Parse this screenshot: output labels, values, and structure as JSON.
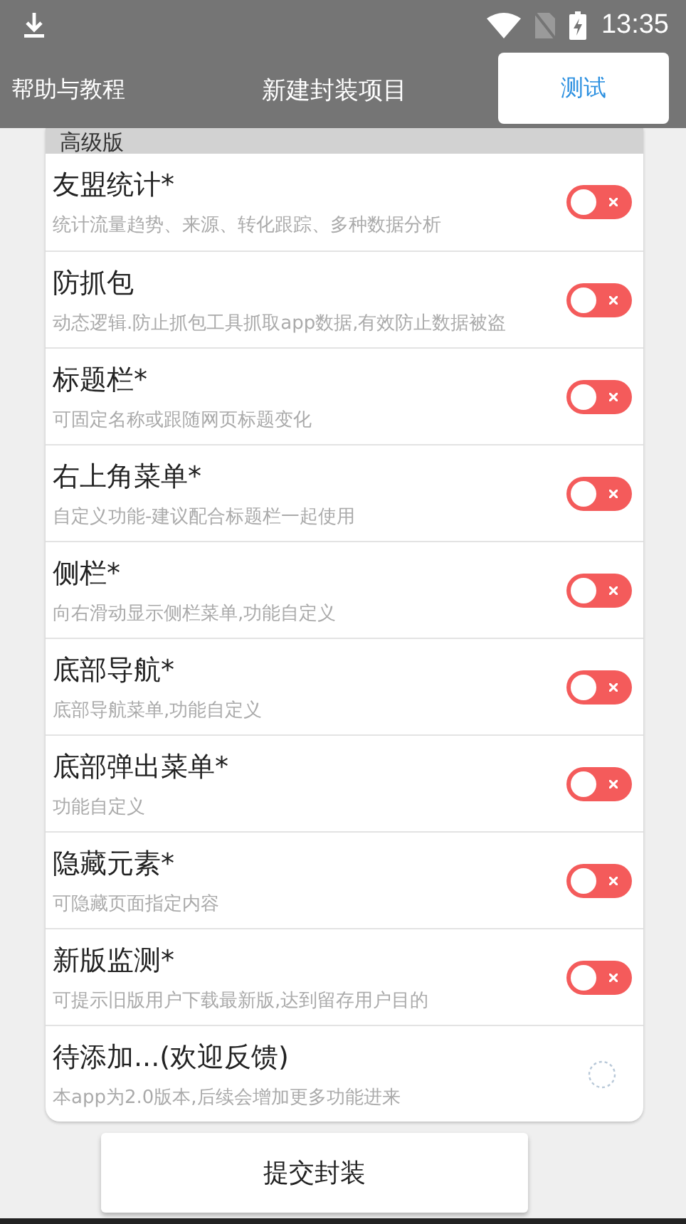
{
  "status_bar": {
    "time": "13:35"
  },
  "app_bar": {
    "left": "帮助与教程",
    "title": "新建封装项目",
    "action": "测试"
  },
  "section": {
    "title": "高级版"
  },
  "features": [
    {
      "kind": "switch",
      "title": "友盟统计*",
      "desc": "统计流量趋势、来源、转化跟踪、多种数据分析",
      "on": false
    },
    {
      "kind": "switch",
      "title": "防抓包",
      "desc": "动态逻辑.防止抓包工具抓取app数据,有效防止数据被盗",
      "on": false
    },
    {
      "kind": "switch",
      "title": "标题栏*",
      "desc": "可固定名称或跟随网页标题变化",
      "on": false
    },
    {
      "kind": "switch",
      "title": "右上角菜单*",
      "desc": "自定义功能-建议配合标题栏一起使用",
      "on": false
    },
    {
      "kind": "switch",
      "title": "侧栏*",
      "desc": "向右滑动显示侧栏菜单,功能自定义",
      "on": false
    },
    {
      "kind": "switch",
      "title": "底部导航*",
      "desc": "底部导航菜单,功能自定义",
      "on": false
    },
    {
      "kind": "switch",
      "title": "底部弹出菜单*",
      "desc": "功能自定义",
      "on": false
    },
    {
      "kind": "switch",
      "title": "隐藏元素*",
      "desc": "可隐藏页面指定内容",
      "on": false
    },
    {
      "kind": "switch",
      "title": "新版监测*",
      "desc": "可提示旧版用户下载最新版,达到留存用户目的",
      "on": false
    },
    {
      "kind": "pending",
      "title": "待添加...(欢迎反馈)",
      "desc": "本app为2.0版本,后续会增加更多功能进来"
    }
  ],
  "submit_button": "提交封装"
}
